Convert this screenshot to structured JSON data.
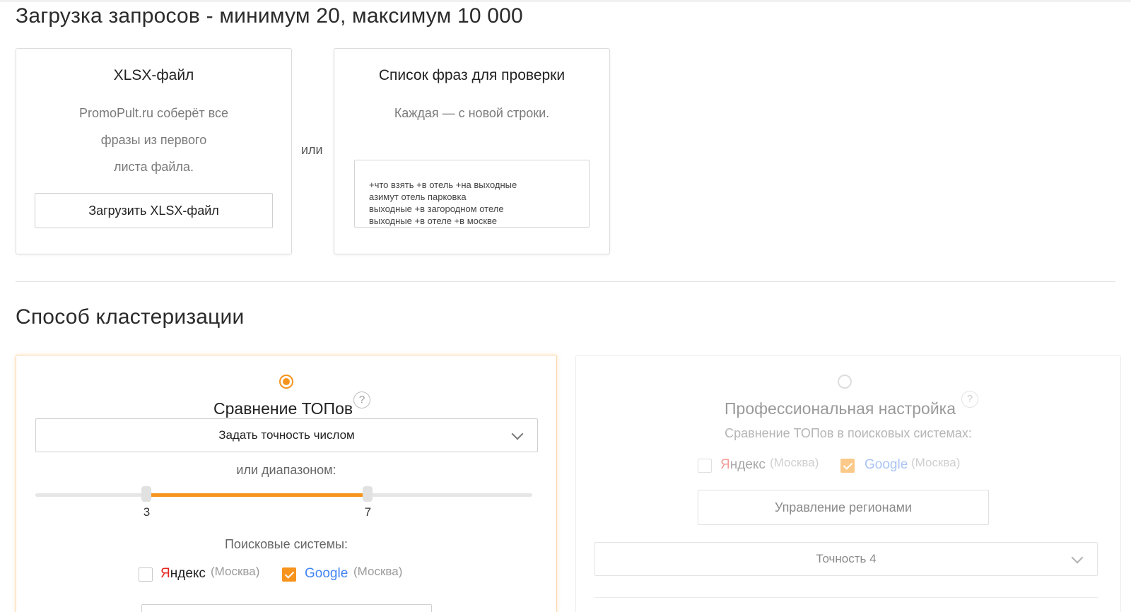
{
  "upload": {
    "heading": "Загрузка запросов - минимум 20, максимум 10 000",
    "or_label": "или",
    "xlsx": {
      "title": "XLSX-файл",
      "desc_line1": "PromoPult.ru соберёт все",
      "desc_line2": "фразы из первого",
      "desc_line3": "листа файла.",
      "button_label": "Загрузить XLSX-файл"
    },
    "phrases": {
      "title": "Список фраз для проверки",
      "desc": "Каждая — с новой строки.",
      "placeholder": "+что взять +в отель +на выходные\nазимут отель парковка\nвыходные +в загородном отеле\nвыходные +в отеле +в москве"
    }
  },
  "clustering": {
    "heading": "Способ кластеризации",
    "top": {
      "title": "Сравнение ТОПов",
      "help": "?",
      "selected": true,
      "select_value": "Задать точность числом",
      "range_label": "или диапазоном:",
      "range_min": "3",
      "range_max": "7",
      "range_low_fraction": 0.224,
      "range_high_fraction": 0.669,
      "search_label": "Поисковые системы:",
      "yandex_first": "Я",
      "yandex_rest": "ндекс",
      "yandex_city": "(Москва)",
      "yandex_checked": false,
      "google_name": "Google",
      "google_city": "(Москва)",
      "google_checked": true
    },
    "pro": {
      "title": "Профессиональная настройка",
      "help": "?",
      "selected": false,
      "subtitle": "Сравнение ТОПов в поисковых системах:",
      "yandex_first": "Я",
      "yandex_rest": "ндекс",
      "yandex_city": "(Москва)",
      "yandex_checked": false,
      "google_name": "Google",
      "google_city": "(Москва)",
      "google_checked": true,
      "regions_button": "Управление регионами",
      "precision_value": "Точность 4"
    }
  },
  "colors": {
    "accent": "#f7941d",
    "yandex_red": "#e52620",
    "google_blue": "#4285f4"
  },
  "icons": {
    "help": "question-circle-icon",
    "chevron": "chevron-down-icon",
    "check": "check-icon"
  }
}
